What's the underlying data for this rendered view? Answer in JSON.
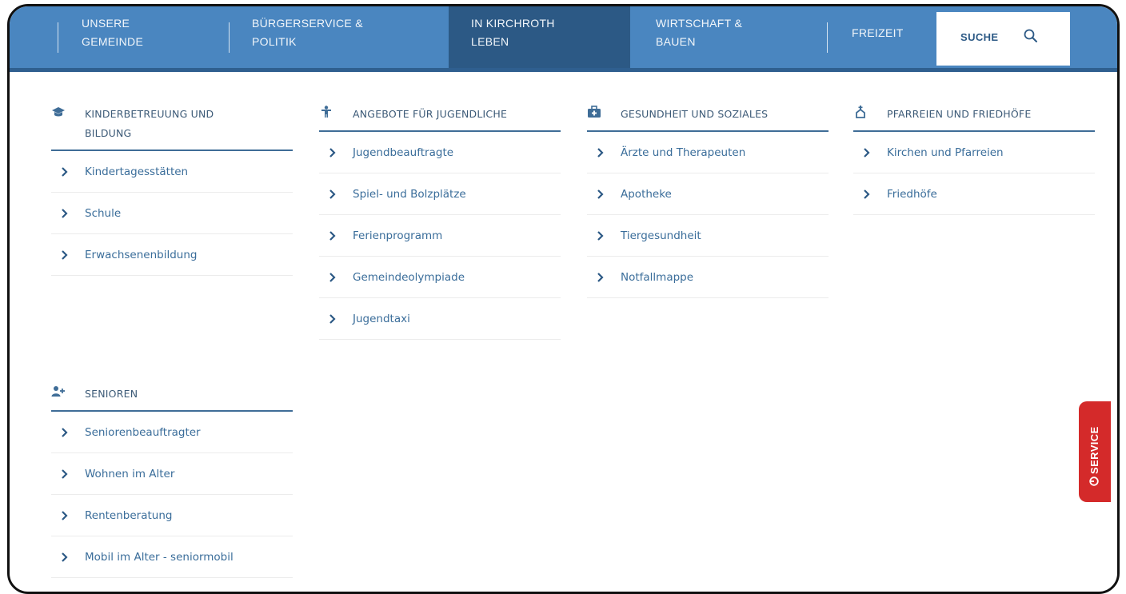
{
  "nav": {
    "items": [
      {
        "line1": "UNSERE",
        "line2": "GEMEINDE"
      },
      {
        "line1": "BÜRGERSERVICE &",
        "line2": "POLITIK"
      },
      {
        "line1": "IN KIRCHROTH",
        "line2": "LEBEN"
      },
      {
        "line1": "WIRTSCHAFT &",
        "line2": "BAUEN"
      },
      {
        "line1": "FREIZEIT",
        "line2": ""
      }
    ],
    "search_label": "SUCHE"
  },
  "menu": {
    "kinder": {
      "title_line1": "KINDERBETREUUNG UND",
      "title_line2": "BILDUNG",
      "links": [
        "Kindertagesstätten",
        "Schule",
        "Erwachsenenbildung"
      ]
    },
    "jugend": {
      "title": "ANGEBOTE FÜR JUGENDLICHE",
      "links": [
        "Jugendbeauftragte",
        "Spiel- und Bolzplätze",
        "Ferienprogramm",
        "Gemeindeolympiade",
        "Jugendtaxi"
      ]
    },
    "gesundheit": {
      "title": "GESUNDHEIT UND SOZIALES",
      "links": [
        "Ärzte und Therapeuten",
        "Apotheke",
        "Tiergesundheit",
        "Notfallmappe"
      ]
    },
    "pfarreien": {
      "title": "PFARREIEN UND FRIEDHÖFE",
      "links": [
        "Kirchen und Pfarreien",
        "Friedhöfe"
      ]
    },
    "senioren": {
      "title": "SENIOREN",
      "links": [
        "Seniorenbeauftragter",
        "Wohnen im Alter",
        "Rentenberatung",
        "Mobil im Alter - seniormobil"
      ]
    }
  },
  "service_tab": {
    "label": "SERVICE"
  },
  "colors": {
    "nav_bg": "#4a86c0",
    "nav_active": "#2c5985",
    "link": "#3a6d9a",
    "service_red": "#d42a2a"
  }
}
